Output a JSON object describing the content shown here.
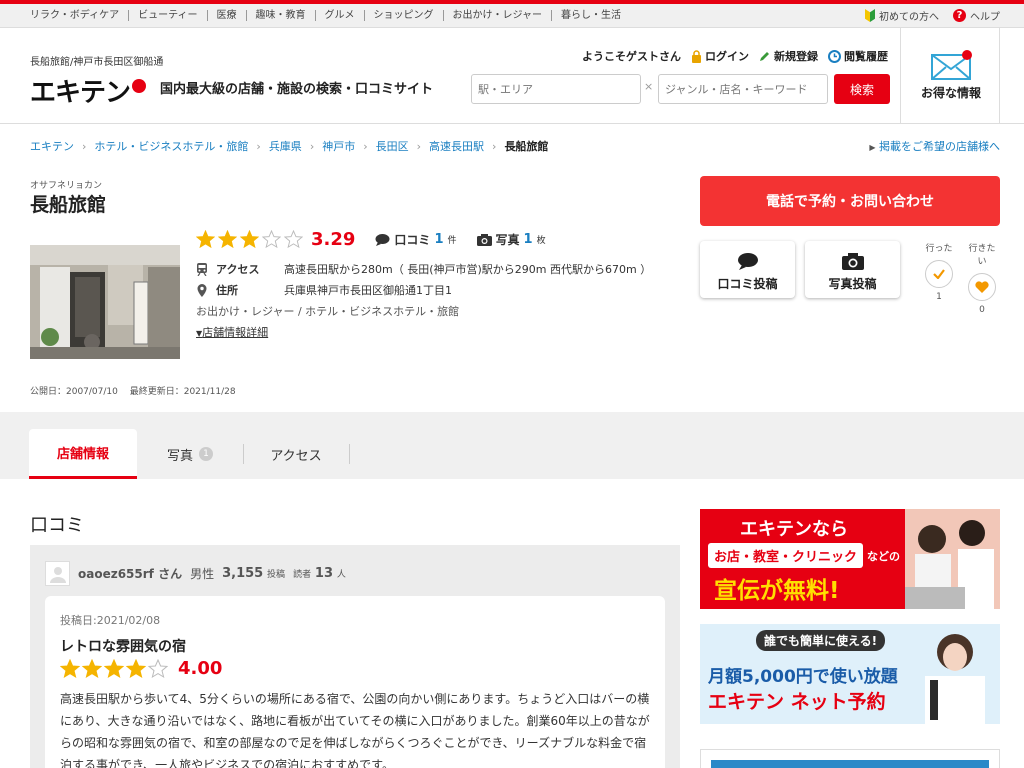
{
  "categories": [
    "リラク・ボディケア",
    "ビューティー",
    "医療",
    "趣味・教育",
    "グルメ",
    "ショッピング",
    "お出かけ・レジャー",
    "暮らし・生活"
  ],
  "help_links": {
    "beginner": "初めての方へ",
    "help": "ヘルプ"
  },
  "header": {
    "tagline_small": "長船旅館/神戸市長田区御船通",
    "logo": "エキテン",
    "tagline_main": "国内最大級の店舗・施設の検索・口コミサイト",
    "welcome": "ようこそゲストさん",
    "login": "ログイン",
    "register": "新規登録",
    "history": "閲覧履歴",
    "station_placeholder": "駅・エリア",
    "clear": "×",
    "keyword_placeholder": "ジャンル・店名・キーワード",
    "search_label": "検索",
    "deal_label": "お得な情報"
  },
  "breadcrumb": [
    "エキテン",
    "ホテル・ビジネスホテル・旅館",
    "兵庫県",
    "神戸市",
    "長田区",
    "高速長田駅",
    "長船旅館"
  ],
  "listing_link": "掲載をご希望の店舗様へ",
  "shop": {
    "kana": "オサフネリョカン",
    "name": "長船旅館",
    "rating": 3.29,
    "rating_text": "3.29",
    "reviews_label": "口コミ",
    "reviews_count": "1",
    "reviews_unit": "件",
    "photos_label": "写真",
    "photos_count": "1",
    "photos_unit": "枚",
    "access_label": "アクセス",
    "access": "高速長田駅から280m（ 長田(神戸市営)駅から290m 西代駅から670m ）",
    "address_label": "住所",
    "address": "兵庫県神戸市長田区御船通1丁目1",
    "category": "お出かけ・レジャー /  ホテル・ビジネスホテル・旅館",
    "detail_link": "店舗情報詳細",
    "dates": "公開日：2007/07/10　 最終更新日：2021/11/28"
  },
  "actions": {
    "call": "電話で予約・お問い合わせ",
    "review_post": "口コミ投稿",
    "photo_post": "写真投稿",
    "went_label": "行った",
    "went_count": "1",
    "want_label": "行きたい",
    "want_count": "0"
  },
  "tabs": {
    "info": "店舗情報",
    "photos": "写真",
    "photos_badge": "1",
    "access": "アクセス"
  },
  "reviews_section": {
    "title": "口コミ",
    "reviewer_name": "oaoez655rf さん",
    "gender": "男性",
    "post_count": "3,155",
    "post_unit": "投稿",
    "readers_label": "読者",
    "readers_count": "13",
    "readers_unit": "人",
    "post_date": "投稿日:2021/02/08",
    "review_title": "レトロな雰囲気の宿",
    "review_rating": 4,
    "review_rating_text": "4.00",
    "review_text": "高速長田駅から歩いて4、5分くらいの場所にある宿で、公園の向かい側にあります。ちょうど入口はバーの横にあり、大きな通り沿いではなく、路地に看板が出ていてその横に入口がありました。創業60年以上の昔ながらの昭和な雰囲気の宿で、和室の部屋なので足を伸ばしながらくつろぐことができ、リーズナブルな料金で宿泊する事ができ、一人旅やビジネスでの宿泊におすすめです。"
  },
  "ads": {
    "ad1_line1": "エキテンなら",
    "ad1_line2": "お店・教室・クリニック",
    "ad1_line2b": "などの",
    "ad1_line3": "宣伝が無料!",
    "ad2_line1": "誰でも簡単に使える!",
    "ad2_line2": "月額5,000円で使い放題",
    "ad2_line3": "エキテン ネット予約"
  },
  "colors": {
    "brand_red": "#e60012",
    "link_blue": "#1a7fc1",
    "star_yellow": "#f5b400"
  }
}
